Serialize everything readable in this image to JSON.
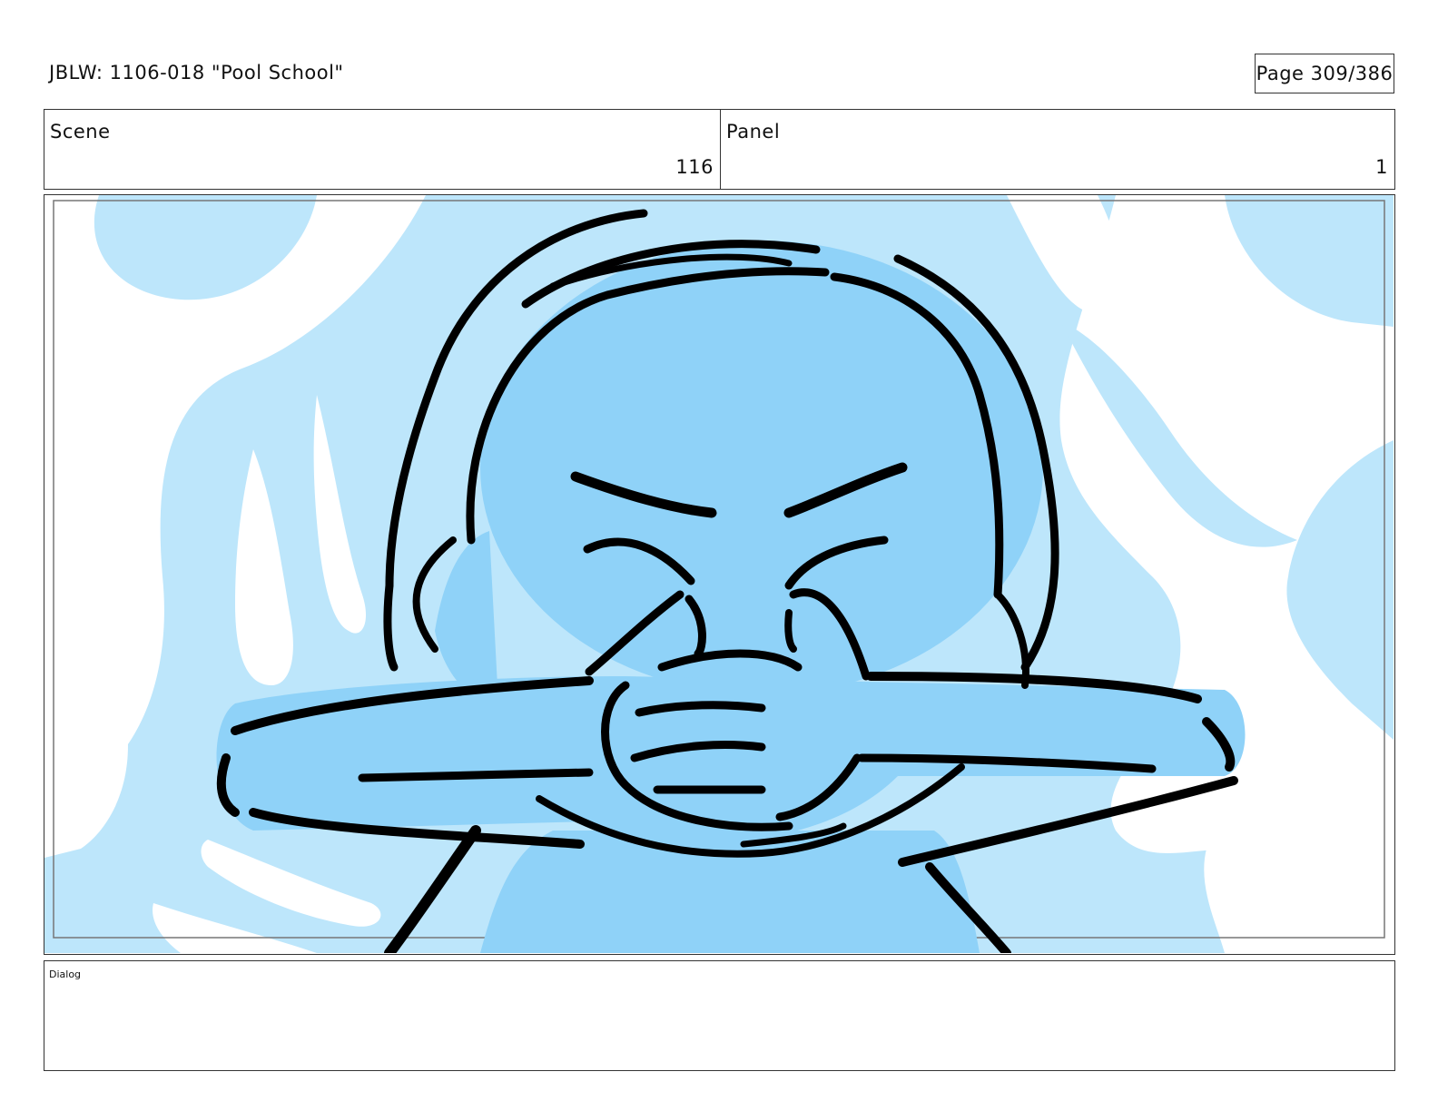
{
  "header": {
    "title": "JBLW: 1106-018 \"Pool School\"",
    "page": "Page 309/386"
  },
  "info": {
    "scene_label": "Scene",
    "scene_value": "116",
    "panel_label": "Panel",
    "panel_value": "1"
  },
  "frame": {
    "illustration": "character-covering-mouth",
    "colors": {
      "background": "#bde6fb",
      "water_highlight": "#ffffff",
      "character": "#8fd2f8",
      "outline": "#000000"
    }
  },
  "dialog": {
    "label": "Dialog"
  }
}
